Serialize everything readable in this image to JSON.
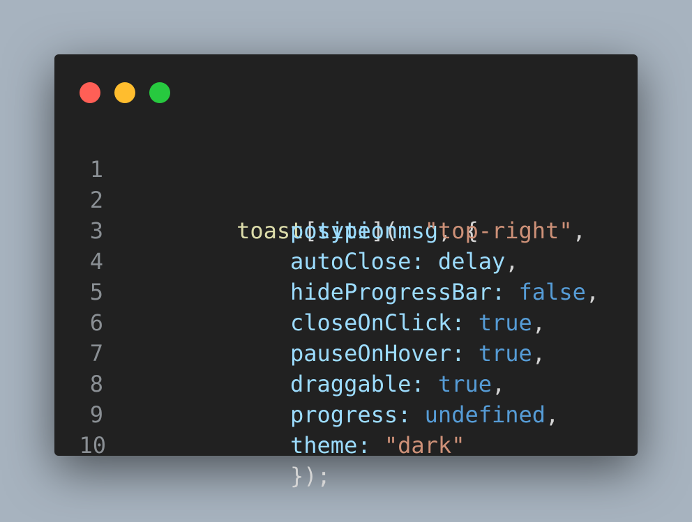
{
  "window": {
    "buttons": {
      "close_color": "#ff5f56",
      "minimize_color": "#ffbd2e",
      "maximize_color": "#27c93f"
    }
  },
  "code": {
    "lines": [
      {
        "number": "1",
        "tokens": [
          {
            "text": "toast",
            "kind": "function"
          },
          {
            "text": "[",
            "kind": "punctuation"
          },
          {
            "text": "type",
            "kind": "variable"
          },
          {
            "text": "](",
            "kind": "punctuation"
          },
          {
            "text": "msg",
            "kind": "variable"
          },
          {
            "text": ", {",
            "kind": "punctuation"
          }
        ]
      },
      {
        "number": "2",
        "tokens": [
          {
            "text": "position",
            "kind": "variable"
          },
          {
            "text": ": ",
            "kind": "variable"
          },
          {
            "text": "\"top-right\"",
            "kind": "string"
          },
          {
            "text": ",",
            "kind": "punctuation"
          }
        ]
      },
      {
        "number": "3",
        "tokens": [
          {
            "text": "autoClose",
            "kind": "variable"
          },
          {
            "text": ": ",
            "kind": "variable"
          },
          {
            "text": "delay",
            "kind": "variable"
          },
          {
            "text": ",",
            "kind": "punctuation"
          }
        ]
      },
      {
        "number": "4",
        "tokens": [
          {
            "text": "hideProgressBar",
            "kind": "variable"
          },
          {
            "text": ": ",
            "kind": "variable"
          },
          {
            "text": "false",
            "kind": "keyword"
          },
          {
            "text": ",",
            "kind": "punctuation"
          }
        ]
      },
      {
        "number": "5",
        "tokens": [
          {
            "text": "closeOnClick",
            "kind": "variable"
          },
          {
            "text": ": ",
            "kind": "variable"
          },
          {
            "text": "true",
            "kind": "keyword"
          },
          {
            "text": ",",
            "kind": "punctuation"
          }
        ]
      },
      {
        "number": "6",
        "tokens": [
          {
            "text": "pauseOnHover",
            "kind": "variable"
          },
          {
            "text": ": ",
            "kind": "variable"
          },
          {
            "text": "true",
            "kind": "keyword"
          },
          {
            "text": ",",
            "kind": "punctuation"
          }
        ]
      },
      {
        "number": "7",
        "tokens": [
          {
            "text": "draggable",
            "kind": "variable"
          },
          {
            "text": ": ",
            "kind": "variable"
          },
          {
            "text": "true",
            "kind": "keyword"
          },
          {
            "text": ",",
            "kind": "punctuation"
          }
        ]
      },
      {
        "number": "8",
        "tokens": [
          {
            "text": "progress",
            "kind": "variable"
          },
          {
            "text": ": ",
            "kind": "variable"
          },
          {
            "text": "undefined",
            "kind": "keyword"
          },
          {
            "text": ",",
            "kind": "punctuation"
          }
        ]
      },
      {
        "number": "9",
        "tokens": [
          {
            "text": "theme",
            "kind": "variable"
          },
          {
            "text": ": ",
            "kind": "variable"
          },
          {
            "text": "\"dark\"",
            "kind": "string"
          }
        ]
      },
      {
        "number": "10",
        "tokens": [
          {
            "text": "});",
            "kind": "punctuation"
          }
        ]
      }
    ]
  }
}
